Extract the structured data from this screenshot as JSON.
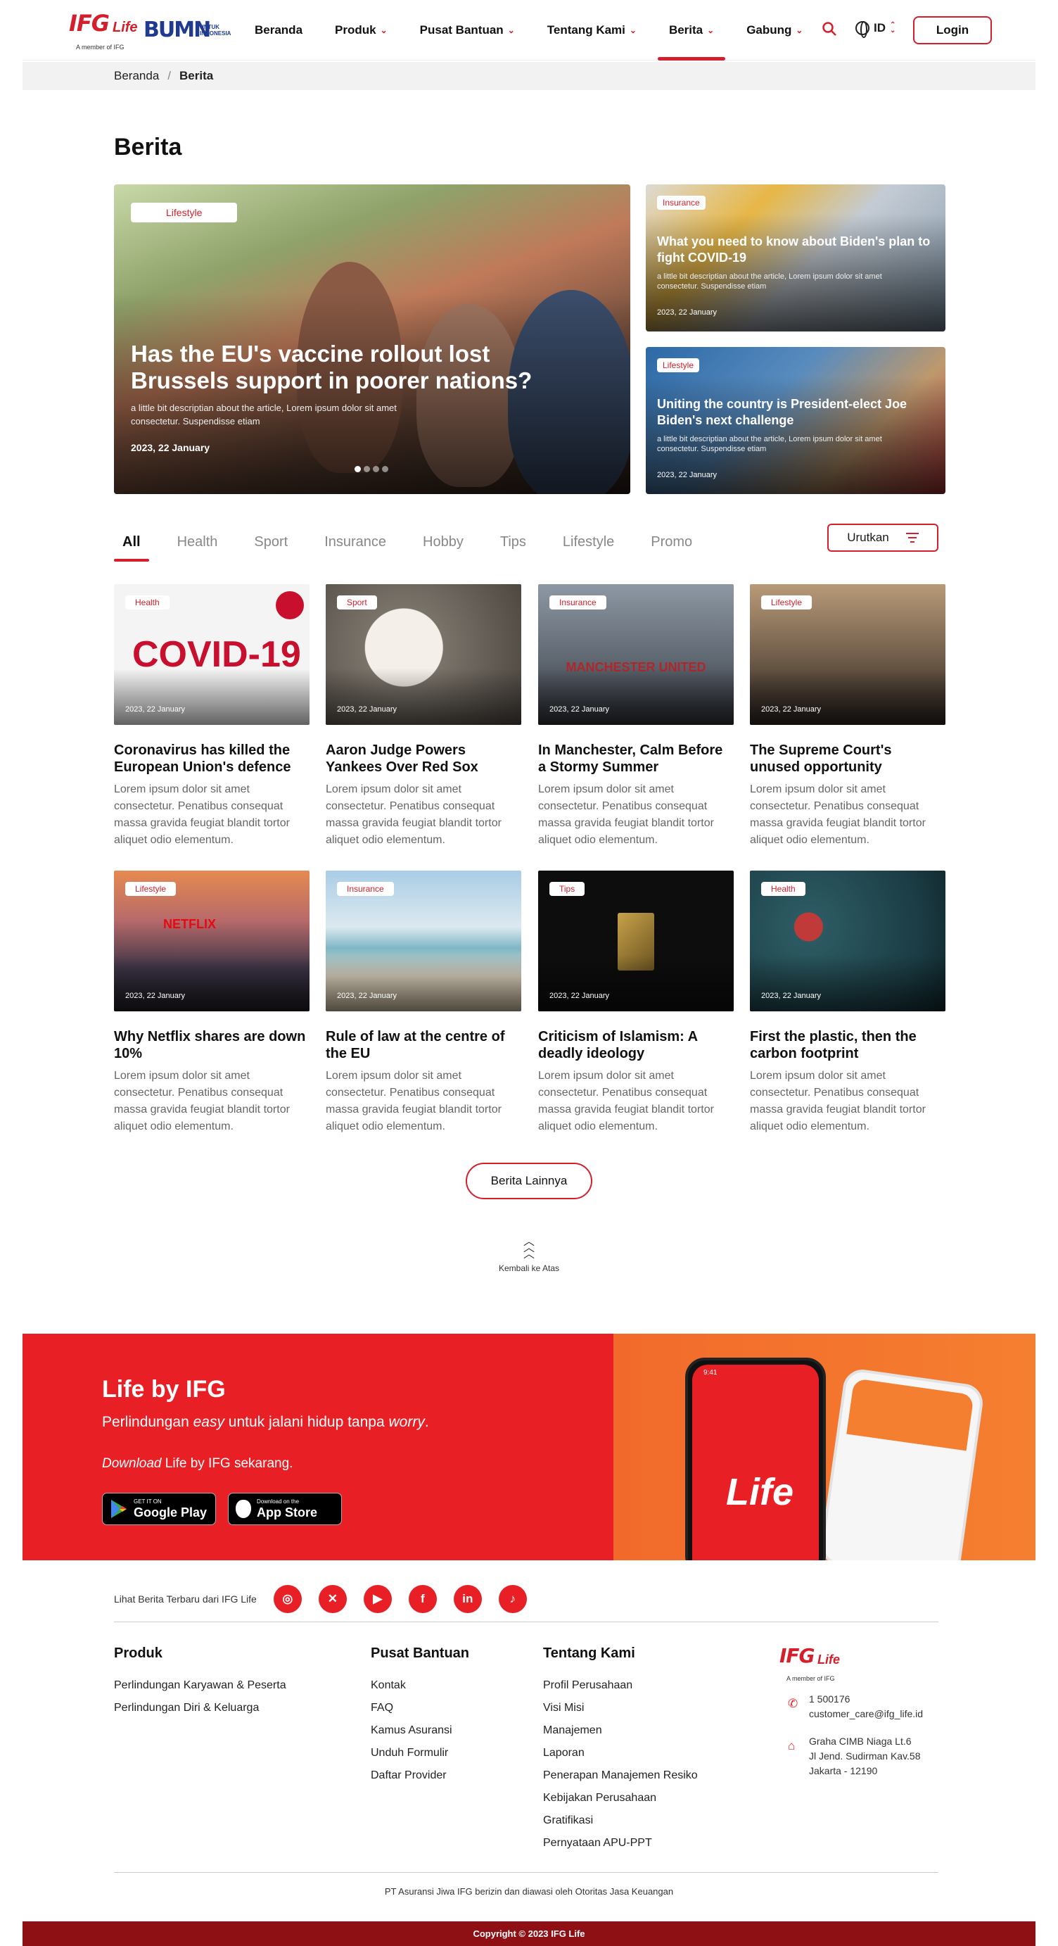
{
  "nav": {
    "logo_text": "IFG",
    "logo_sub": "Life",
    "logo_member": "A member of IFG",
    "bumn_logo": "BUMN",
    "bumn_sub": "UNTUK INDONESIA",
    "items": [
      {
        "label": "Beranda",
        "dropdown": false
      },
      {
        "label": "Produk",
        "dropdown": true
      },
      {
        "label": "Pusat Bantuan",
        "dropdown": true
      },
      {
        "label": "Tentang Kami",
        "dropdown": true
      },
      {
        "label": "Berita",
        "dropdown": true,
        "active": true
      },
      {
        "label": "Gabung",
        "dropdown": true
      }
    ],
    "lang": "ID",
    "login": "Login",
    "search_icon": "search-icon",
    "globe_icon": "globe-icon"
  },
  "breadcrumb": {
    "home": "Beranda",
    "sep": "/",
    "current": "Berita"
  },
  "page_title": "Berita",
  "hero": {
    "category": "Lifestyle",
    "title": "Has the EU's vaccine rollout lost Brussels support in poorer nations?",
    "desc": "a little bit descriptian about the article, Lorem ipsum dolor sit amet consectetur. Suspendisse etiam",
    "date": "2023, 22 January",
    "slides": 4,
    "active_slide": 1
  },
  "side": [
    {
      "category": "Insurance",
      "title": "What you need to know about Biden's plan to fight COVID-19",
      "desc": "a little bit descriptian about the article, Lorem ipsum dolor sit amet consectetur. Suspendisse etiam",
      "date": "2023, 22 January"
    },
    {
      "category": "Lifestyle",
      "title": "Uniting the country is President-elect Joe Biden's next challenge",
      "desc": "a little bit descriptian about the article, Lorem ipsum dolor sit amet consectetur. Suspendisse etiam",
      "date": "2023, 22 January"
    }
  ],
  "tabs": [
    "All",
    "Health",
    "Sport",
    "Insurance",
    "Hobby",
    "Tips",
    "Lifestyle",
    "Promo"
  ],
  "active_tab": "All",
  "sort_label": "Urutkan",
  "cards": [
    {
      "category": "Health",
      "date": "2023, 22 January",
      "title": "Coronavirus has killed the European Union's defence",
      "desc": "Lorem ipsum dolor sit amet consectetur. Penatibus consequat massa gravida feugiat blandit tortor aliquet odio elementum.",
      "image_text": "COVID-19"
    },
    {
      "category": "Sport",
      "date": "2023, 22 January",
      "title": "Aaron Judge Powers Yankees Over Red Sox",
      "desc": "Lorem ipsum dolor sit amet consectetur. Penatibus consequat massa gravida feugiat blandit tortor aliquet odio elementum."
    },
    {
      "category": "Insurance",
      "date": "2023, 22 January",
      "title": "In Manchester, Calm Before a Stormy Summer",
      "desc": "Lorem ipsum dolor sit amet consectetur. Penatibus consequat massa gravida feugiat blandit tortor aliquet odio elementum.",
      "image_text": "MANCHESTER UNITED"
    },
    {
      "category": "Lifestyle",
      "date": "2023, 22 January",
      "title": "The Supreme Court's unused opportunity",
      "desc": "Lorem ipsum dolor sit amet consectetur. Penatibus consequat massa gravida feugiat blandit tortor aliquet odio elementum."
    },
    {
      "category": "Lifestyle",
      "date": "2023, 22 January",
      "title": "Why Netflix shares are down 10%",
      "desc": "Lorem ipsum dolor sit amet consectetur. Penatibus consequat massa gravida feugiat blandit tortor aliquet odio elementum.",
      "image_text": "NETFLIX"
    },
    {
      "category": "Insurance",
      "date": "2023, 22 January",
      "title": "Rule of law at the centre of the EU",
      "desc": "Lorem ipsum dolor sit amet consectetur. Penatibus consequat massa gravida feugiat blandit tortor aliquet odio elementum."
    },
    {
      "category": "Tips",
      "date": "2023, 22 January",
      "title": "Criticism of Islamism: A deadly ideology",
      "desc": "Lorem ipsum dolor sit amet consectetur. Penatibus consequat massa gravida feugiat blandit tortor aliquet odio elementum."
    },
    {
      "category": "Health",
      "date": "2023, 22 January",
      "title": "First the plastic, then the carbon footprint",
      "desc": "Lorem ipsum dolor sit amet consectetur. Penatibus consequat massa gravida feugiat blandit tortor aliquet odio elementum."
    }
  ],
  "more_button": "Berita Lainnya",
  "back_to_top": "Kembali ke Atas",
  "banner": {
    "title": "Life by IFG",
    "sub_pre": "Perlindungan ",
    "sub_em1": "easy",
    "sub_mid": " untuk jalani hidup tanpa ",
    "sub_em2": "worry",
    "sub_post": ".",
    "dl_em": "Download",
    "dl_rest": " Life by IFG sekarang.",
    "google_small": "GET IT ON",
    "google_big": "Google Play",
    "apple_small": "Download on the",
    "apple_big": "App Store",
    "phone_brand": "Life",
    "phone_time": "9:41",
    "brand_color": "#e91f26"
  },
  "footer": {
    "social_label": "Lihat Berita Terbaru dari IFG Life",
    "social": [
      "instagram-icon",
      "x-icon",
      "youtube-icon",
      "facebook-icon",
      "linkedin-icon",
      "tiktok-icon"
    ],
    "cols": [
      {
        "title": "Produk",
        "links": [
          "Perlindungan Karyawan & Peserta",
          "Perlindungan Diri & Keluarga"
        ]
      },
      {
        "title": "Pusat Bantuan",
        "links": [
          "Kontak",
          "FAQ",
          "Kamus Asuransi",
          "Unduh Formulir",
          "Daftar Provider"
        ]
      },
      {
        "title": "Tentang Kami",
        "links": [
          "Profil Perusahaan",
          "Visi Misi",
          "Manajemen",
          "Laporan",
          "Penerapan Manajemen Resiko",
          "Kebijakan Perusahaan",
          "Gratifikasi",
          "Pernyataan APU-PPT"
        ]
      }
    ],
    "phone": "1 500176",
    "email": "customer_care@ifg_life.id",
    "address": [
      "Graha CIMB Niaga Lt.6",
      "Jl Jend. Sudirman Kav.58",
      "Jakarta - 12190"
    ],
    "legal": "PT Asuransi Jiwa IFG berizin dan diawasi oleh Otoritas Jasa Keuangan",
    "copyright": "Copyright © 2023 IFG Life"
  }
}
